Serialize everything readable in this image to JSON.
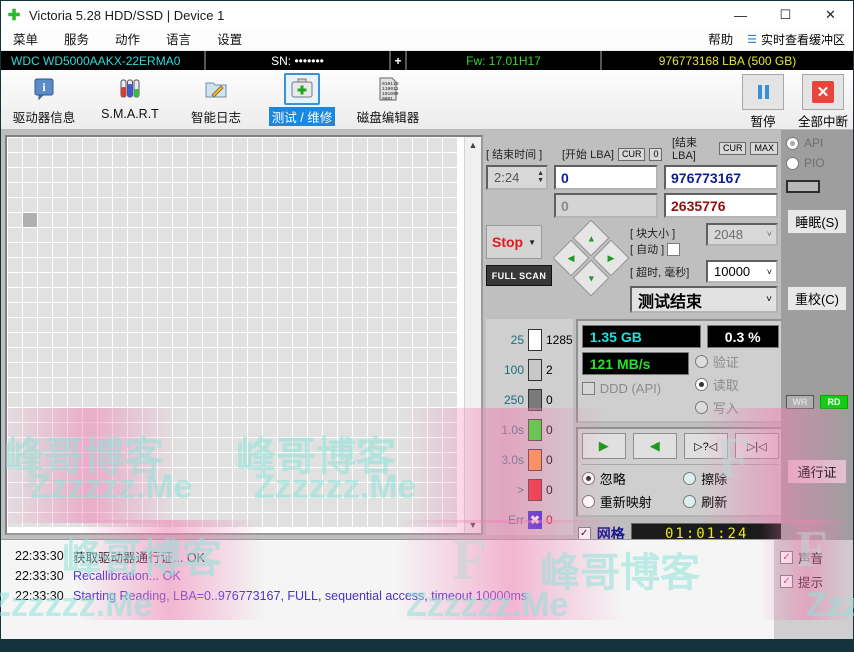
{
  "window": {
    "title": "Victoria 5.28 HDD/SSD | Device 1",
    "app_icon": "green-cross-icon",
    "minimize": "—",
    "maximize": "☐",
    "close": "✕"
  },
  "menubar": {
    "items": [
      "菜单",
      "服务",
      "动作",
      "语言",
      "设置",
      "帮助"
    ],
    "right_label": "实时查看缓冲区"
  },
  "drivebar": {
    "model": "WDC WD5000AAKX-22ERMA0",
    "sn_label": "SN:",
    "sn_value": "•••••••",
    "plus": "+",
    "fw": "Fw: 17.01H17",
    "lba": "976773168 LBA (500 GB)"
  },
  "toolbar": {
    "tabs": [
      {
        "label": "驱动器信息",
        "icon": "info-icon",
        "active": false
      },
      {
        "label": "S.M.A.R.T",
        "icon": "test-tubes-icon",
        "active": false
      },
      {
        "label": "智能日志",
        "icon": "folder-pencil-icon",
        "active": false
      },
      {
        "label": "测试 / 维修",
        "icon": "first-aid-kit-icon",
        "active": true
      },
      {
        "label": "磁盘编辑器",
        "icon": "binary-page-icon",
        "active": false
      }
    ],
    "pause_label": "暂停",
    "stopall_label": "全部中断"
  },
  "test_params": {
    "end_time_label": "[ 结束时间 ]",
    "end_time_value": "2:24",
    "start_lba_label": "[开始 LBA]",
    "start_lba_cur": "CUR",
    "start_lba_zero": "0",
    "start_lba_value": "0",
    "start_lba_value2": "0",
    "end_lba_label": "[结束 LBA]",
    "end_lba_cur": "CUR",
    "end_lba_max": "MAX",
    "end_lba_value": "976773167",
    "end_lba_value2": "2635776",
    "block_size_label": "[ 块大小 ]",
    "block_size_value": "2048",
    "auto_label": "[ 自动 ]",
    "timeout_label": "[ 超时, 毫秒]",
    "timeout_value": "10000",
    "mode_value": "测试结束",
    "stop_label": "Stop",
    "full_scan_label": "FULL SCAN"
  },
  "legend": {
    "rows": [
      {
        "key": "25",
        "color": "#ffffff",
        "count": "1285"
      },
      {
        "key": "100",
        "color": "#c8c8c8",
        "count": "2"
      },
      {
        "key": "250",
        "color": "#7a7a7a",
        "count": "0"
      },
      {
        "key": "1.0s",
        "color": "#14f014",
        "count": "0"
      },
      {
        "key": "3.0s",
        "color": "#ff9933",
        "count": "0"
      },
      {
        "key": ">",
        "color": "#f02020",
        "count": "0"
      },
      {
        "key": "Err",
        "color": "#2020d8",
        "count": "0"
      }
    ]
  },
  "stats": {
    "volume": "1.35 GB",
    "percent": "0.3    %",
    "speed": "121 MB/s",
    "ddd_label": "DDD (API)",
    "verify_label": "验证",
    "read_label": "读取",
    "write_label": "写入",
    "selected_op": "读取"
  },
  "actions": {
    "play_icon": "play-icon",
    "reverse_icon": "reverse-play-icon",
    "random_icon": "random-seek-icon",
    "butterfly_icon": "butterfly-seek-icon",
    "radios": [
      {
        "label": "忽略",
        "checked": true
      },
      {
        "label": "擦除",
        "checked": false
      },
      {
        "label": "重新映射",
        "checked": false
      },
      {
        "label": "刷新",
        "checked": false
      }
    ],
    "grid_label": "网格",
    "grid_checked": true,
    "timer": "01:01:24"
  },
  "rail": {
    "api_label": "API",
    "pio_label": "PIO",
    "sleep_label": "睡眠(S)",
    "recal_label": "重校(C)",
    "wr_label": "WR",
    "rd_label": "RD",
    "pass_label": "通行证"
  },
  "log": {
    "rows": [
      {
        "time": "22:33:30",
        "message": "获取驱动器通行证... OK",
        "chinese": true
      },
      {
        "time": "22:33:30",
        "message": "Recallibration... OK",
        "chinese": false
      },
      {
        "time": "22:33:30",
        "message": "Starting Reading, LBA=0..976773167, FULL, sequential access, timeout 10000ms",
        "chinese": false
      }
    ],
    "sound_label": "声音",
    "tip_label": "提示"
  },
  "watermark": {
    "texts": [
      "峰哥博客",
      "Zzzzzz.Me",
      "F"
    ]
  }
}
